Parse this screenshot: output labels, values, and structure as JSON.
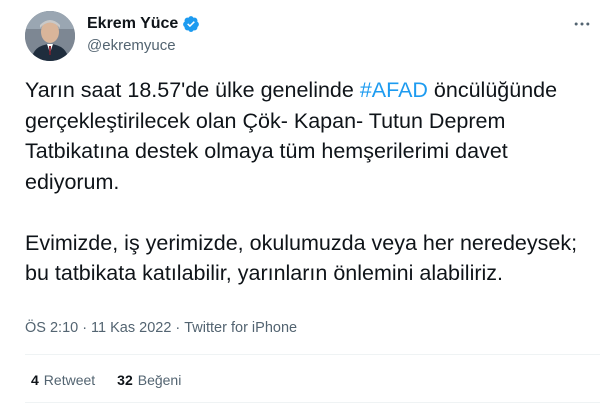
{
  "author": {
    "name": "Ekrem Yüce",
    "handle": "@ekremyuce",
    "verified": true
  },
  "tweet": {
    "text_before": "Yarın saat 18.57'de ülke genelinde ",
    "hashtag": "#AFAD",
    "text_after": " öncülüğünde gerçekleştirilecek olan Çök- Kapan- Tutun Deprem Tatbikatına destek olmaya tüm hemşerilerimi davet ediyorum.\n\nEvimizde, iş yerimizde, okulumuzda veya her neredeysek; bu tatbikata katılabilir, yarınların önlemini alabiliriz."
  },
  "meta": {
    "time": "ÖS 2:10",
    "separator1": "·",
    "date": "11 Kas 2022",
    "separator2": "·",
    "source": "Twitter for iPhone"
  },
  "stats": {
    "retweets_count": "4",
    "retweets_label": "Retweet",
    "likes_count": "32",
    "likes_label": "Beğeni"
  },
  "colors": {
    "accent": "#1d9bf0",
    "secondary_text": "#536471",
    "primary_text": "#0f1419"
  },
  "icons": {
    "verified": "verified-badge-icon",
    "more": "more-options-icon"
  }
}
